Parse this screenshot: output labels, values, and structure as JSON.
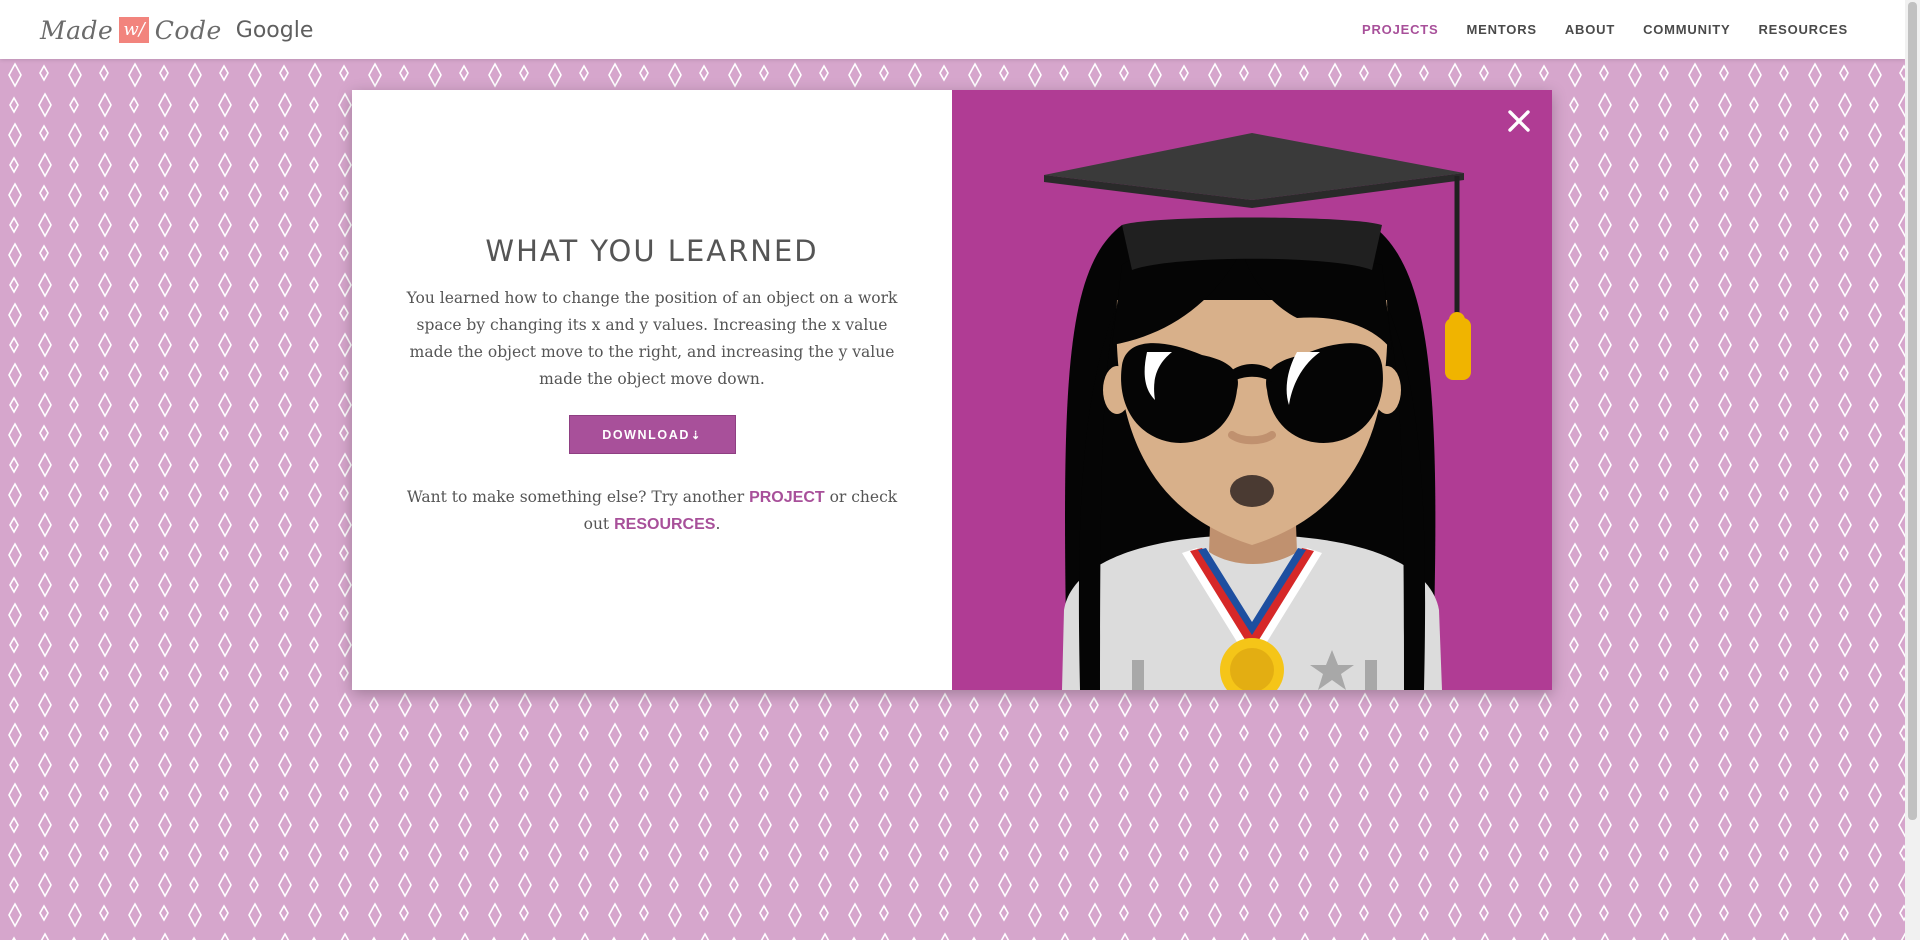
{
  "header": {
    "logo": {
      "made": "Made",
      "mark": "w/",
      "code": "Code",
      "google": "Google"
    },
    "nav": [
      {
        "label": "PROJECTS",
        "active": true
      },
      {
        "label": "MENTORS",
        "active": false
      },
      {
        "label": "ABOUT",
        "active": false
      },
      {
        "label": "COMMUNITY",
        "active": false
      },
      {
        "label": "RESOURCES",
        "active": false
      }
    ]
  },
  "modal": {
    "title": "WHAT YOU LEARNED",
    "body": "You learned how to change the position of an object on a work space by changing its x and y values. Increasing the x value made the object move to the right, and increasing the y value made the object move down.",
    "download_label": "DOWNLOAD",
    "download_icon": "⇣",
    "cta_before": "Want to make something else? Try another ",
    "cta_project_link": "PROJECT",
    "cta_middle": " or check out ",
    "cta_resources_link": "RESOURCES",
    "cta_after": ".",
    "close_icon": "close-icon"
  },
  "colors": {
    "brand_purple": "#a8509a",
    "panel_magenta": "#b03c94",
    "background_pink": "#d6a6cc",
    "logo_accent": "#f2847d"
  }
}
